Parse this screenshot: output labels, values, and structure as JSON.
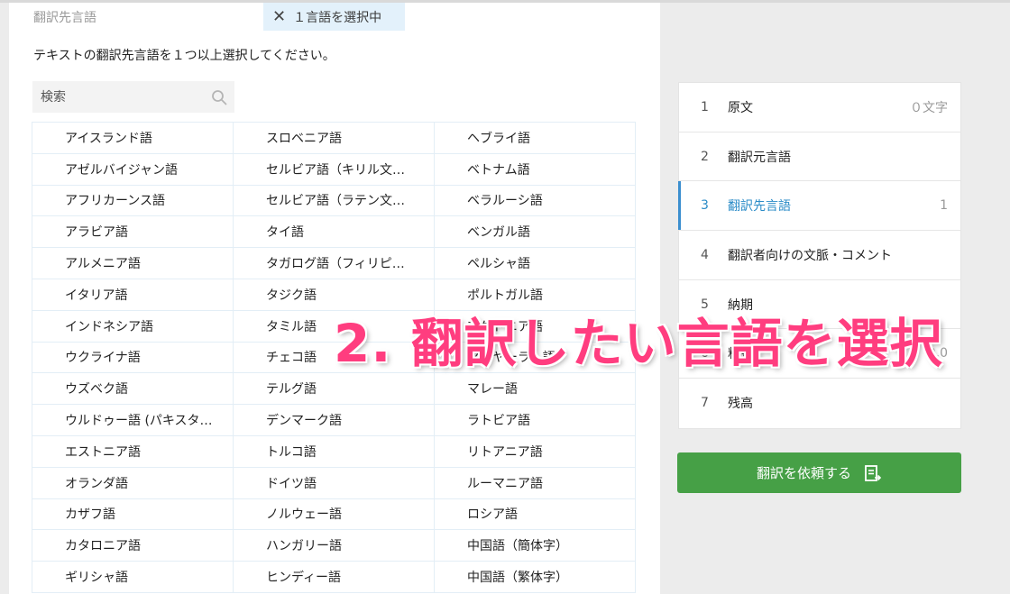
{
  "header": {
    "label": "翻訳先言語",
    "selected_chip": "１言語を選択中",
    "close_glyph": "✕"
  },
  "instruction": "テキストの翻訳先言語を１つ以上選択してください。",
  "search": {
    "placeholder": "検索",
    "value": ""
  },
  "languages": [
    [
      "アイスランド語",
      "スロベニア語",
      "ヘブライ語"
    ],
    [
      "アゼルバイジャン語",
      "セルビア語（キリル文…",
      "ベトナム語"
    ],
    [
      "アフリカーンス語",
      "セルビア語（ラテン文…",
      "ベラルーシ語"
    ],
    [
      "アラビア語",
      "タイ語",
      "ベンガル語"
    ],
    [
      "アルメニア語",
      "タガログ語（フィリピ…",
      "ペルシャ語"
    ],
    [
      "イタリア語",
      "タジク語",
      "ポルトガル語"
    ],
    [
      "インドネシア語",
      "タミル語",
      "マケドニア語"
    ],
    [
      "ウクライナ語",
      "チェコ語",
      "マラヤーラム語"
    ],
    [
      "ウズベク語",
      "テルグ語",
      "マレー語"
    ],
    [
      "ウルドゥー語 (パキスタ…",
      "デンマーク語",
      "ラトビア語"
    ],
    [
      "エストニア語",
      "トルコ語",
      "リトアニア語"
    ],
    [
      "オランダ語",
      "ドイツ語",
      "ルーマニア語"
    ],
    [
      "カザフ語",
      "ノルウェー語",
      "ロシア語"
    ],
    [
      "カタロニア語",
      "ハンガリー語",
      "中国語（簡体字）"
    ],
    [
      "ギリシャ語",
      "ヒンディー語",
      "中国語（繁体字）"
    ]
  ],
  "steps": [
    {
      "num": "1",
      "label": "原文",
      "meta": "０文字"
    },
    {
      "num": "2",
      "label": "翻訳元言語",
      "meta": ""
    },
    {
      "num": "3",
      "label": "翻訳先言語",
      "meta": "1",
      "active": true
    },
    {
      "num": "4",
      "label": "翻訳者向けの文脈・コメント",
      "meta": ""
    },
    {
      "num": "5",
      "label": "納期",
      "meta": ""
    },
    {
      "num": "6",
      "label": "料金",
      "meta": "0.0"
    },
    {
      "num": "7",
      "label": "残高",
      "meta": ""
    }
  ],
  "request_button": "翻訳を依頼する",
  "overlay_text": "2. 翻訳したい言語を選択",
  "colors": {
    "accent": "#2a8bc7",
    "button": "#46a046",
    "overlay": "#ff3d7f",
    "chip": "#e3f1fb"
  }
}
